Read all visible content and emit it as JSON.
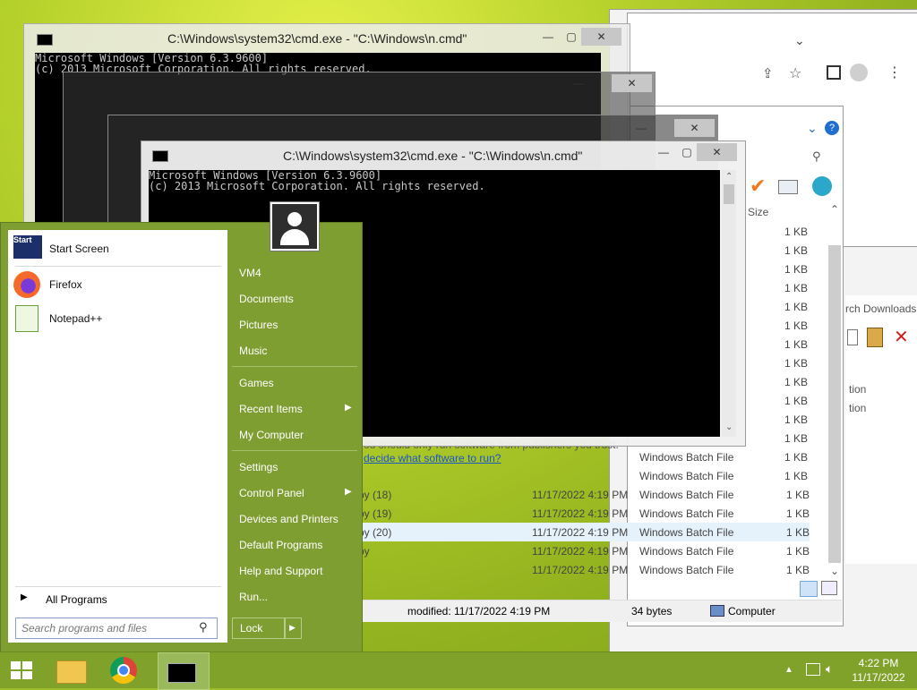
{
  "cmd": {
    "title": "C:\\Windows\\system32\\cmd.exe - \"C:\\Windows\\n.cmd\"",
    "line1": "Microsoft Windows [Version 6.3.9600]",
    "line2": "(c) 2013 Microsoft Corporation. All rights reserved."
  },
  "explorer": {
    "column_size": "Size",
    "search_placeholder": "rch Downloads",
    "sizes": [
      "1 KB",
      "1 KB",
      "1 KB",
      "1 KB",
      "1 KB",
      "1 KB",
      "1 KB",
      "1 KB",
      "1 KB",
      "1 KB",
      "1 KB",
      "1 KB",
      "1 KB",
      "1 KB",
      "1 KB",
      "1 KB",
      "1 KB",
      "1 KB",
      "1 KB"
    ],
    "files": [
      {
        "name": "py (18)",
        "date": "11/17/2022 4:19 PM",
        "type": "Windows Batch File",
        "size": "1 KB"
      },
      {
        "name": "py (19)",
        "date": "11/17/2022 4:19 PM",
        "type": "Windows Batch File",
        "size": "1 KB"
      },
      {
        "name": "py (20)",
        "date": "11/17/2022 4:19 PM",
        "type": "Windows Batch File",
        "size": "1 KB"
      },
      {
        "name": "py",
        "date": "11/17/2022 4:19 PM",
        "type": "Windows Batch File",
        "size": "1 KB"
      },
      {
        "name": "",
        "date": "11/17/2022 4:19 PM",
        "type": "Windows Batch File",
        "size": "1 KB"
      }
    ],
    "batch_types": [
      "Windows Batch File",
      "Windows Batch File"
    ],
    "info_text": "ou should only run software from publishers you trust.",
    "info_link": "decide what software to run?",
    "status_modified": "modified: 11/17/2022 4:19 PM",
    "status_size": "34 bytes",
    "status_location": "Computer",
    "side_text1": "tion",
    "side_text2": "tion"
  },
  "start_menu": {
    "pinned": [
      {
        "label": "Start Screen",
        "icon": "start-screen-icon"
      },
      {
        "label": "Firefox",
        "icon": "firefox-icon"
      },
      {
        "label": "Notepad++",
        "icon": "notepadpp-icon"
      }
    ],
    "all_programs": "All Programs",
    "search_placeholder": "Search programs and files",
    "right_items": [
      "VM4",
      "Documents",
      "Pictures",
      "Music",
      "Games",
      "Recent Items",
      "My Computer",
      "Settings",
      "Control Panel",
      "Devices and Printers",
      "Default Programs",
      "Help and Support",
      "Run..."
    ],
    "lock_label": "Lock"
  },
  "taskbar": {
    "time": "4:22 PM",
    "date": "11/17/2022"
  }
}
